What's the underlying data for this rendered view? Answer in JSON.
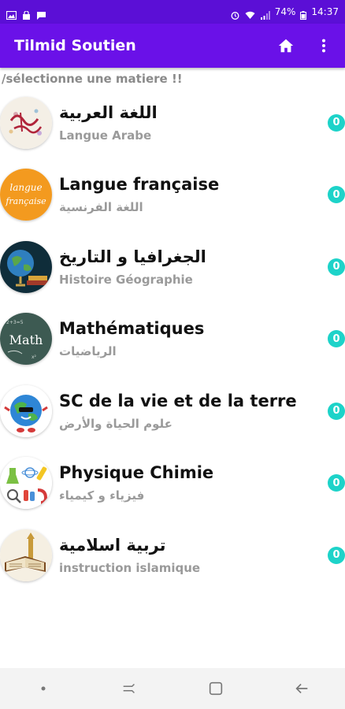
{
  "status_bar": {
    "battery": "74%",
    "time": "14:37",
    "icons": [
      "gallery-icon",
      "lock-icon",
      "message-icon",
      "alarm-icon",
      "wifi-icon",
      "signal-icon",
      "battery-icon"
    ]
  },
  "app_bar": {
    "title": "Tilmid Soutien",
    "actions": [
      "home-icon",
      "more-vert-icon"
    ]
  },
  "prompt": "/sélectionne une matiere !!",
  "subjects": [
    {
      "title": "اللغة العربية",
      "subtitle": "Langue Arabe",
      "count": "0",
      "icon": "arabic-calligraphy-icon"
    },
    {
      "title": "Langue française",
      "subtitle": "اللغة الفرنسية",
      "count": "0",
      "icon": "langue-francaise-icon"
    },
    {
      "title": "الجغرافيا و التاريخ",
      "subtitle": "Histoire Géographie",
      "count": "0",
      "icon": "globe-books-icon"
    },
    {
      "title": "Mathématiques",
      "subtitle": "الرياضيات",
      "count": "0",
      "icon": "math-chalkboard-icon"
    },
    {
      "title": "SC de la vie et de la terre",
      "subtitle": "علوم الحياة والأرض",
      "count": "0",
      "icon": "earth-character-icon"
    },
    {
      "title": "Physique Chimie",
      "subtitle": "فيزياء و كيمياء",
      "count": "0",
      "icon": "science-tools-icon"
    },
    {
      "title": "تربية اسلامية",
      "subtitle": "instruction islamique",
      "count": "0",
      "icon": "quran-book-icon"
    }
  ],
  "nav_bar": [
    "recent-dot-icon",
    "recent-apps-icon",
    "home-square-icon",
    "back-arrow-icon"
  ],
  "colors": {
    "status_bar": "#5b0fd6",
    "app_bar": "#6a11e8",
    "badge": "#1dd3c9",
    "prompt_text": "#8a8a8a",
    "subtitle_text": "#9a9a9a"
  }
}
